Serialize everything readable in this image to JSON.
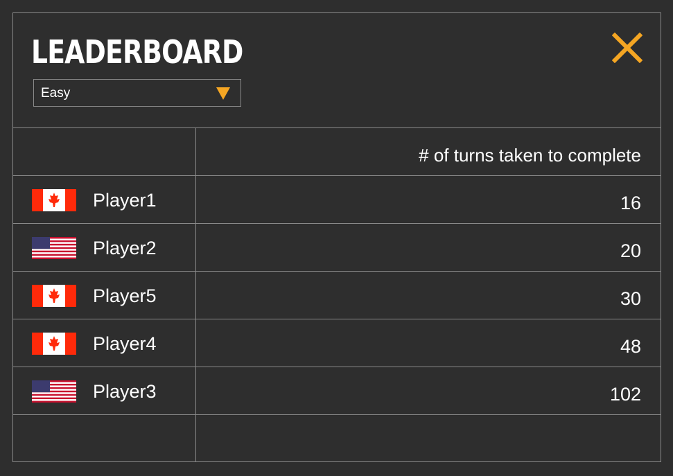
{
  "header": {
    "title": "LEADERBOARD",
    "close_icon": "close-icon",
    "accent_color": "#f5a623"
  },
  "difficulty": {
    "selected": "Easy",
    "icon": "triangle-down-icon"
  },
  "table": {
    "column_header": "# of turns taken to complete",
    "rows": [
      {
        "flag": "canada-flag-icon",
        "player": "Player1",
        "turns": "16"
      },
      {
        "flag": "usa-flag-icon",
        "player": "Player2",
        "turns": "20"
      },
      {
        "flag": "canada-flag-icon",
        "player": "Player5",
        "turns": "30"
      },
      {
        "flag": "canada-flag-icon",
        "player": "Player4",
        "turns": "48"
      },
      {
        "flag": "usa-flag-icon",
        "player": "Player3",
        "turns": "102"
      }
    ]
  }
}
